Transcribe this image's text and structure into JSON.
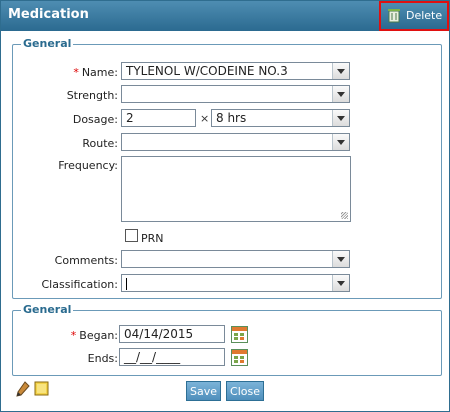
{
  "window": {
    "title": "Medication",
    "delete_label": "Delete"
  },
  "general": {
    "legend": "General",
    "name": {
      "label": "Name:",
      "value": "TYLENOL W/CODEINE NO.3"
    },
    "strength": {
      "label": "Strength:",
      "value": ""
    },
    "dosage": {
      "label": "Dosage:",
      "amount": "2",
      "times": "×",
      "frequency": "8 hrs"
    },
    "route": {
      "label": "Route:",
      "value": ""
    },
    "frequency": {
      "label": "Frequency:",
      "value": ""
    },
    "prn": {
      "label": "PRN"
    },
    "comments": {
      "label": "Comments:",
      "value": ""
    },
    "classification": {
      "label": "Classification:",
      "value": ""
    }
  },
  "dates": {
    "legend": "General",
    "began": {
      "label": "Began:",
      "value": "04/14/2015"
    },
    "ends": {
      "label": "Ends:",
      "value": "__/__/____"
    }
  },
  "required_marker": "*",
  "footer": {
    "save_label": "Save",
    "close_label": "Close"
  },
  "colors": {
    "title_bg": "#2b6a90",
    "legend": "#2a6b8f",
    "required": "#dd0000",
    "delete_highlight": "#e01010"
  }
}
